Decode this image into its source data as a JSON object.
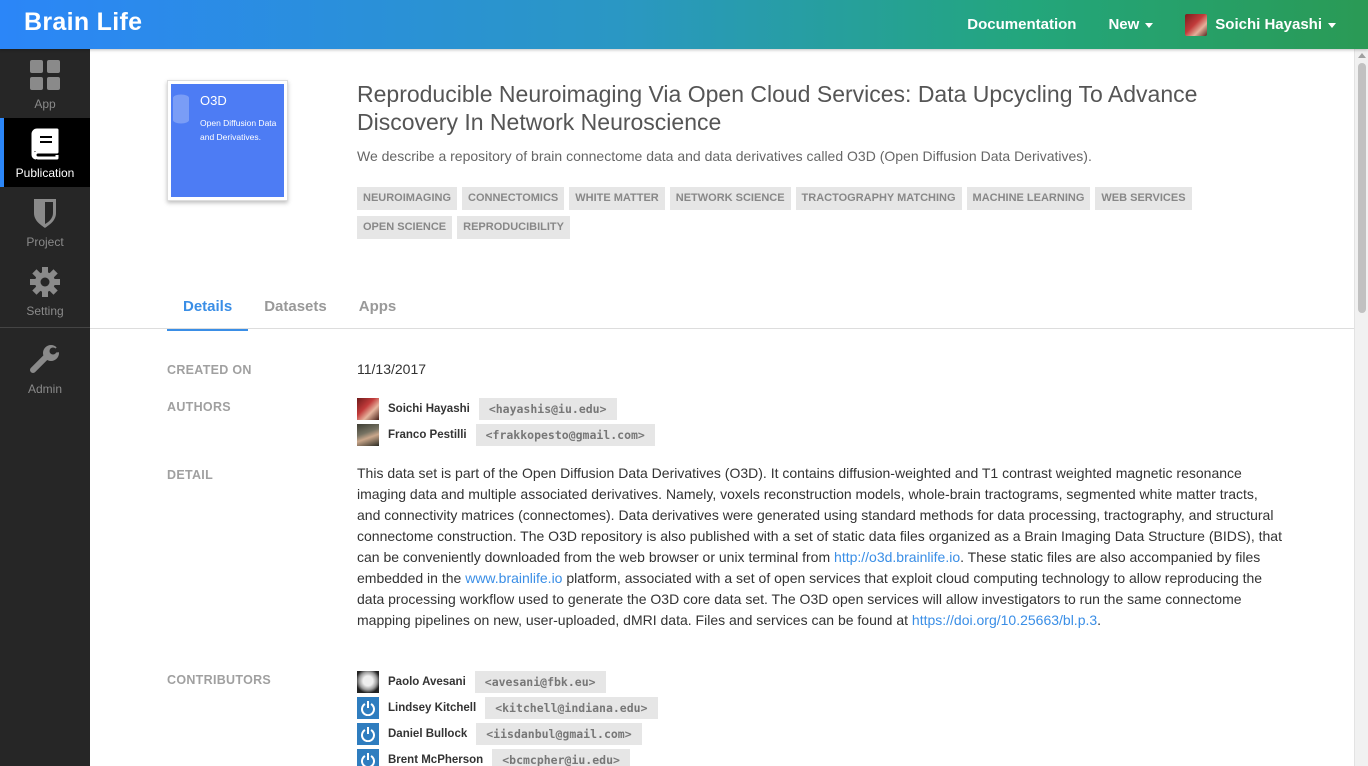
{
  "brand": "Brain Life",
  "topnav": {
    "documentation": "Documentation",
    "new": "New",
    "user": "Soichi Hayashi"
  },
  "sidebar": {
    "items": [
      {
        "label": "App",
        "icon": "grid-icon"
      },
      {
        "label": "Publication",
        "icon": "book-icon"
      },
      {
        "label": "Project",
        "icon": "shield-icon"
      },
      {
        "label": "Setting",
        "icon": "gear-icon"
      },
      {
        "label": "Admin",
        "icon": "wrench-icon"
      }
    ]
  },
  "thumbnail": {
    "title": "O3D",
    "desc": "Open Diffusion Data and Derivatives."
  },
  "publication": {
    "title": "Reproducible Neuroimaging Via Open Cloud Services: Data Upcycling To Advance Discovery In Network Neuroscience",
    "desc": "We describe a repository of brain connectome data and data derivatives called O3D (Open Diffusion Data Derivatives).",
    "tags": [
      "NEUROIMAGING",
      "CONNECTOMICS",
      "WHITE MATTER",
      "NETWORK SCIENCE",
      "TRACTOGRAPHY MATCHING",
      "MACHINE LEARNING",
      "WEB SERVICES",
      "OPEN SCIENCE",
      "REPRODUCIBILITY"
    ]
  },
  "tabs": [
    "Details",
    "Datasets",
    "Apps"
  ],
  "details": {
    "created_label": "CREATED ON",
    "created_value": "11/13/2017",
    "authors_label": "AUTHORS",
    "authors": [
      {
        "name": "Soichi Hayashi",
        "email": "<hayashis@iu.edu>"
      },
      {
        "name": "Franco Pestilli",
        "email": "<frakkopesto@gmail.com>"
      }
    ],
    "detail_label": "DETAIL",
    "detail_text_1": "This data set is part of the Open Diffusion Data Derivatives (O3D). It contains diffusion-weighted and T1 contrast weighted magnetic resonance imaging data and multiple associated derivatives. Namely, voxels reconstruction models, whole-brain tractograms, segmented white matter tracts, and connectivity matrices (connectomes). Data derivatives were generated using standard methods for data processing, tractography, and structural connectome construction. The O3D repository is also published with a set of static data files organized as a Brain Imaging Data Structure (BIDS), that can be conveniently downloaded from the web browser or unix terminal from ",
    "detail_link_1": "http://o3d.brainlife.io",
    "detail_text_2": ". These static files are also accompanied by files embedded in the ",
    "detail_link_2": "www.brainlife.io",
    "detail_text_3": " platform, associated with a set of open services that exploit cloud computing technology to allow reproducing the data processing workflow used to generate the O3D core data set. The O3D open services will allow investigators to run the same connectome mapping pipelines on new, user-uploaded, dMRI data. Files and services can be found at ",
    "detail_link_3": "https://doi.org/10.25663/bl.p.3",
    "detail_text_4": ".",
    "contributors_label": "CONTRIBUTORS",
    "contributors": [
      {
        "name": "Paolo Avesani",
        "email": "<avesani@fbk.eu>"
      },
      {
        "name": "Lindsey Kitchell",
        "email": "<kitchell@indiana.edu>"
      },
      {
        "name": "Daniel Bullock",
        "email": "<iisdanbul@gmail.com>"
      },
      {
        "name": "Brent McPherson",
        "email": "<bcmcpher@iu.edu>"
      }
    ]
  },
  "colors": {
    "accent": "#3a8ee6",
    "sidebar_bg": "#262626",
    "thumb_bg": "#4d7cf4"
  }
}
